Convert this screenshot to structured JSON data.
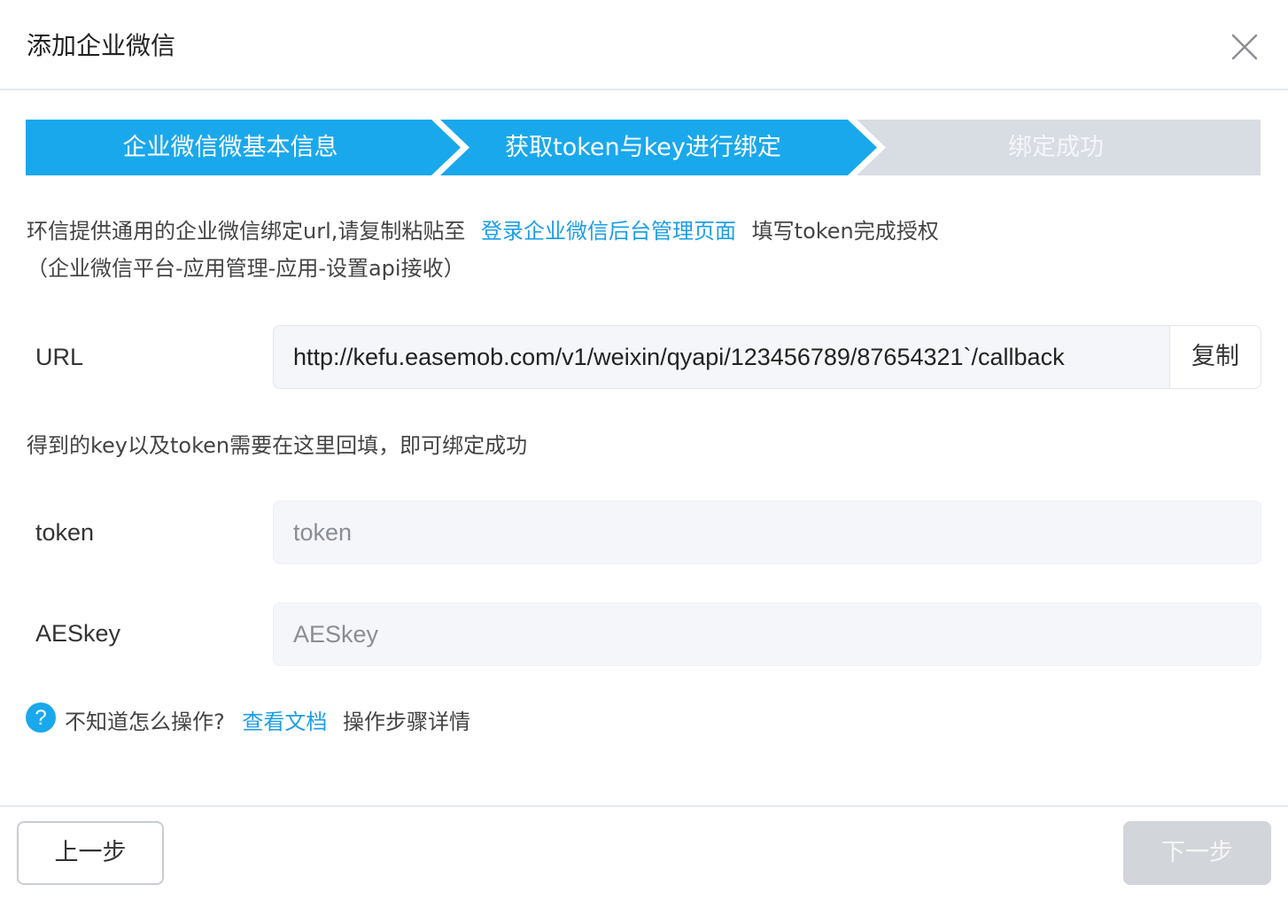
{
  "dialog": {
    "title": "添加企业微信"
  },
  "steps": [
    {
      "label": "企业微信微基本信息",
      "state": "done"
    },
    {
      "label": "获取token与key进行绑定",
      "state": "active"
    },
    {
      "label": "绑定成功",
      "state": "pending"
    }
  ],
  "colors": {
    "accent": "#1aa8ec",
    "step_pending": "#d8dce3",
    "link": "#1d9ee6",
    "disabled_button": "#d2d5d9"
  },
  "instructions": {
    "text_before_link": "环信提供通用的企业微信绑定url,请复制粘贴至",
    "link_text": "登录企业微信后台管理页面",
    "text_after_link": "填写token完成授权",
    "line2": "（企业微信平台-应用管理-应用-设置api接收）"
  },
  "url_field": {
    "label": "URL",
    "value": "http://kefu.easemob.com/v1/weixin/qyapi/123456789/87654321`/callback",
    "copy_label": "复制"
  },
  "hint": "得到的key以及token需要在这里回填，即可绑定成功",
  "token_field": {
    "label": "token",
    "placeholder": "token",
    "value": ""
  },
  "aeskey_field": {
    "label": "AESkey",
    "placeholder": "AESkey",
    "value": ""
  },
  "help": {
    "icon": "question-circle-icon",
    "text_before": "不知道怎么操作?",
    "link_text": "查看文档",
    "text_after": "操作步骤详情"
  },
  "footer": {
    "prev_label": "上一步",
    "next_label": "下一步"
  }
}
